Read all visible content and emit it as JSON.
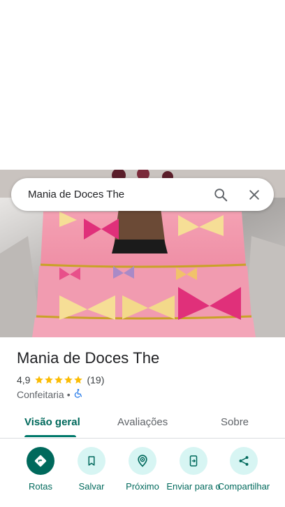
{
  "search": {
    "query": "Mania de Doces The"
  },
  "place": {
    "name": "Mania de Doces The",
    "rating": "4,9",
    "stars": 5,
    "review_count": "(19)",
    "category": "Confeitaria",
    "separator": "•"
  },
  "tabs": [
    {
      "label": "Visão geral",
      "active": true
    },
    {
      "label": "Avaliações",
      "active": false
    },
    {
      "label": "Sobre",
      "active": false
    }
  ],
  "actions": [
    {
      "label": "Rotas",
      "icon": "directions-icon"
    },
    {
      "label": "Salvar",
      "icon": "bookmark-icon"
    },
    {
      "label": "Próximo",
      "icon": "nearby-icon"
    },
    {
      "label": "Enviar para o",
      "icon": "send-to-phone-icon"
    },
    {
      "label": "Compartilhar",
      "icon": "share-icon"
    }
  ],
  "colors": {
    "accent": "#00695c",
    "accent_light": "#d7f5f3",
    "star": "#fbbc04",
    "accessibility": "#1a73e8"
  }
}
